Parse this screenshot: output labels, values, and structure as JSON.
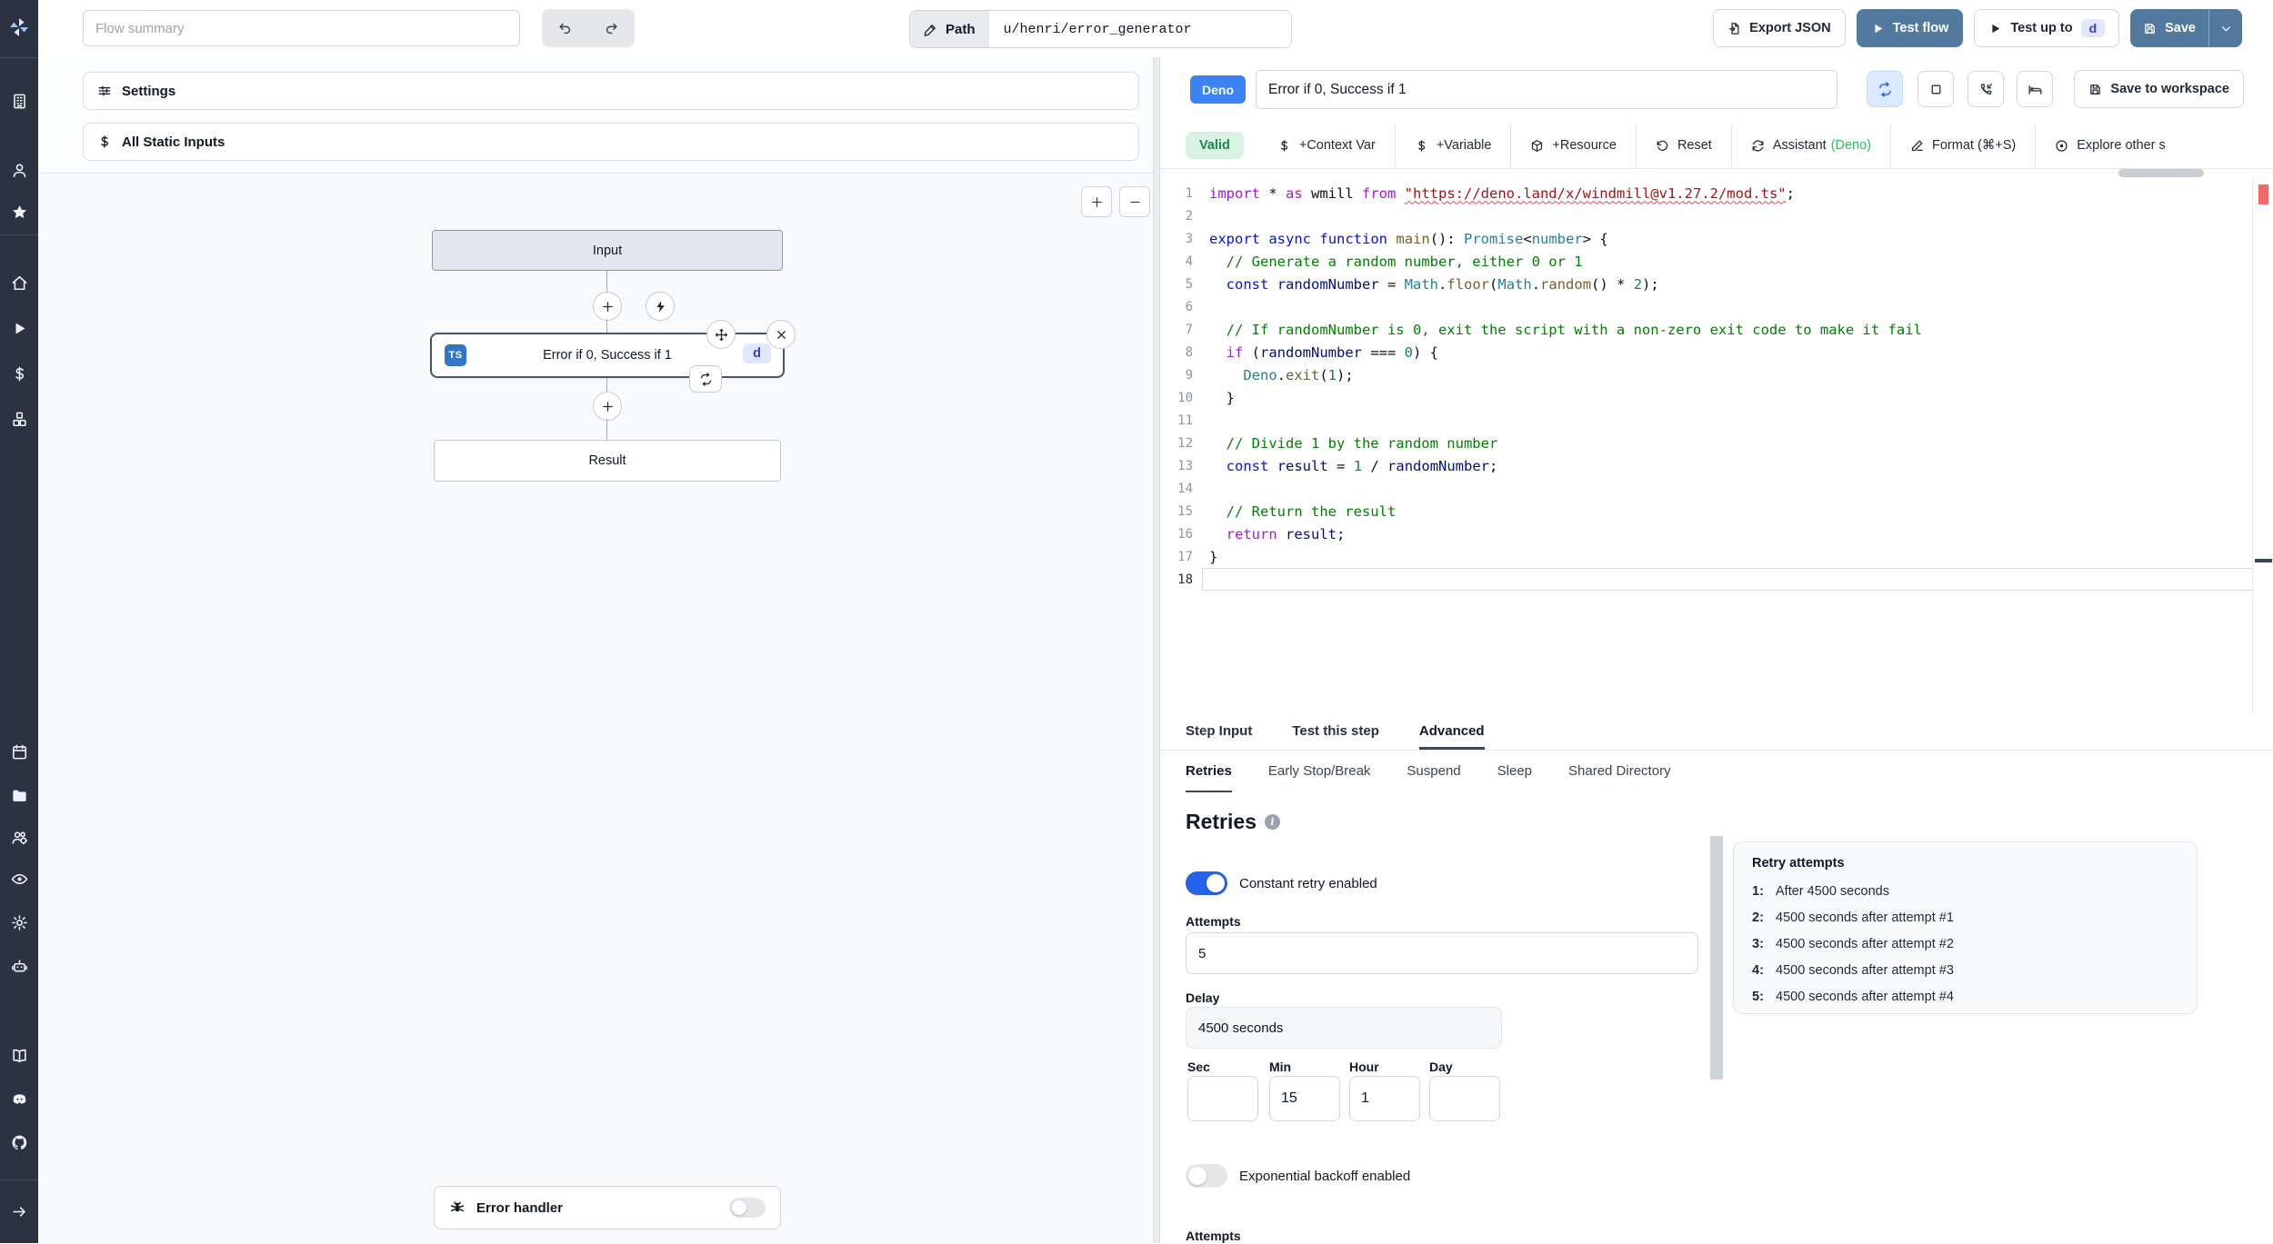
{
  "colors": {
    "sidebar_bg": "#2b3342",
    "primary_button": "#54799e",
    "deno_badge": "#3b82f6",
    "toggle_on": "#2563eb",
    "valid_bg": "#d8f3e3",
    "valid_text": "#178a4c",
    "step_badge_bg": "#e0e7ff",
    "step_badge_text": "#4338ca",
    "ts_badge": "#3077c6"
  },
  "sidebar": {
    "icons": [
      "building",
      "user",
      "star",
      "home",
      "play",
      "dollar",
      "cubes",
      "calendar",
      "folder",
      "users",
      "eye",
      "gear",
      "robot",
      "book",
      "discord",
      "github",
      "arrow-right"
    ]
  },
  "topbar": {
    "flow_summary_placeholder": "Flow summary",
    "path_label": "Path",
    "path_value": "u/henri/error_generator",
    "export_json": "Export JSON",
    "test_flow": "Test flow",
    "test_up_to": "Test up to",
    "test_up_to_badge": "d",
    "save": "Save"
  },
  "left_panel": {
    "settings": "Settings",
    "static_inputs": "All Static Inputs",
    "nodes": {
      "input": "Input",
      "step_title": "Error if 0, Success if 1",
      "step_lang_badge": "TS",
      "step_id_badge": "d",
      "result": "Result"
    },
    "error_handler": "Error handler"
  },
  "step_header": {
    "lang": "Deno",
    "title": "Error if 0, Success if 1",
    "icon_buttons": [
      "repeat",
      "square",
      "phone-in",
      "bed"
    ],
    "save_to_workspace": "Save to workspace"
  },
  "code_toolbar": {
    "valid": "Valid",
    "items": [
      {
        "icon": "dollar",
        "label": "+Context Var"
      },
      {
        "icon": "dollar",
        "label": "+Variable"
      },
      {
        "icon": "cube",
        "label": "+Resource"
      },
      {
        "icon": "rotate-ccw",
        "label": "Reset"
      },
      {
        "icon": "refresh",
        "label": "Assistant ",
        "suffix": "(Deno)"
      },
      {
        "icon": "pen",
        "label": "Format (⌘+S)"
      },
      {
        "icon": "explore",
        "label": "Explore other s"
      }
    ]
  },
  "editor": {
    "lines": [
      {
        "n": 1,
        "toks": [
          [
            "p",
            "import"
          ],
          [
            "d",
            " * "
          ],
          [
            "p",
            "as"
          ],
          [
            "d",
            " wmill "
          ],
          [
            "p",
            "from"
          ],
          [
            "d",
            " "
          ],
          [
            "u",
            "\"https://deno.land/x/windmill@v1.27.2/mod.ts\""
          ],
          [
            "d",
            ";"
          ]
        ]
      },
      {
        "n": 2,
        "toks": []
      },
      {
        "n": 3,
        "toks": [
          [
            "k",
            "export"
          ],
          [
            "d",
            " "
          ],
          [
            "k",
            "async"
          ],
          [
            "d",
            " "
          ],
          [
            "k",
            "function"
          ],
          [
            "d",
            " "
          ],
          [
            "f",
            "main"
          ],
          [
            "d",
            "(): "
          ],
          [
            "t",
            "Promise"
          ],
          [
            "d",
            "<"
          ],
          [
            "t",
            "number"
          ],
          [
            "d",
            "> {"
          ]
        ]
      },
      {
        "n": 4,
        "toks": [
          [
            "c",
            "  // Generate a random number, either 0 or 1"
          ]
        ]
      },
      {
        "n": 5,
        "toks": [
          [
            "d",
            "  "
          ],
          [
            "k",
            "const"
          ],
          [
            "d",
            " "
          ],
          [
            "v",
            "randomNumber"
          ],
          [
            "d",
            " = "
          ],
          [
            "t",
            "Math"
          ],
          [
            "d",
            "."
          ],
          [
            "f",
            "floor"
          ],
          [
            "d",
            "("
          ],
          [
            "t",
            "Math"
          ],
          [
            "d",
            "."
          ],
          [
            "f",
            "random"
          ],
          [
            "d",
            "() * "
          ],
          [
            "n",
            "2"
          ],
          [
            "d",
            ");"
          ]
        ]
      },
      {
        "n": 6,
        "toks": []
      },
      {
        "n": 7,
        "toks": [
          [
            "c",
            "  // If randomNumber is 0, exit the script with a non-zero exit code to make it fail"
          ]
        ]
      },
      {
        "n": 8,
        "toks": [
          [
            "d",
            "  "
          ],
          [
            "p",
            "if"
          ],
          [
            "d",
            " ("
          ],
          [
            "v",
            "randomNumber"
          ],
          [
            "d",
            " === "
          ],
          [
            "n",
            "0"
          ],
          [
            "d",
            ") {"
          ]
        ]
      },
      {
        "n": 9,
        "toks": [
          [
            "d",
            "    "
          ],
          [
            "t",
            "Deno"
          ],
          [
            "d",
            "."
          ],
          [
            "f",
            "exit"
          ],
          [
            "d",
            "("
          ],
          [
            "n",
            "1"
          ],
          [
            "d",
            ");"
          ]
        ]
      },
      {
        "n": 10,
        "toks": [
          [
            "d",
            "  }"
          ]
        ]
      },
      {
        "n": 11,
        "toks": []
      },
      {
        "n": 12,
        "toks": [
          [
            "c",
            "  // Divide 1 by the random number"
          ]
        ]
      },
      {
        "n": 13,
        "toks": [
          [
            "d",
            "  "
          ],
          [
            "k",
            "const"
          ],
          [
            "d",
            " "
          ],
          [
            "v",
            "result"
          ],
          [
            "d",
            " = "
          ],
          [
            "n",
            "1"
          ],
          [
            "d",
            " / "
          ],
          [
            "v",
            "randomNumber"
          ],
          [
            "d",
            ";"
          ]
        ]
      },
      {
        "n": 14,
        "toks": []
      },
      {
        "n": 15,
        "toks": [
          [
            "c",
            "  // Return the result"
          ]
        ]
      },
      {
        "n": 16,
        "toks": [
          [
            "d",
            "  "
          ],
          [
            "p",
            "return"
          ],
          [
            "d",
            " "
          ],
          [
            "v",
            "result"
          ],
          [
            "d",
            ";"
          ]
        ]
      },
      {
        "n": 17,
        "toks": [
          [
            "d",
            "}"
          ]
        ]
      },
      {
        "n": 18,
        "toks": [],
        "current": true
      }
    ]
  },
  "step_panel": {
    "tabs": [
      {
        "label": "Step Input",
        "active": false
      },
      {
        "label": "Test this step",
        "active": false
      },
      {
        "label": "Advanced",
        "active": true
      }
    ],
    "subtabs": [
      {
        "label": "Retries",
        "active": true
      },
      {
        "label": "Early Stop/Break",
        "active": false
      },
      {
        "label": "Suspend",
        "active": false
      },
      {
        "label": "Sleep",
        "active": false
      },
      {
        "label": "Shared Directory",
        "active": false
      }
    ]
  },
  "retries": {
    "heading": "Retries",
    "constant_toggle_label": "Constant retry enabled",
    "attempts_label": "Attempts",
    "attempts_value": "5",
    "delay_label": "Delay",
    "delay_value": "4500 seconds",
    "units": [
      {
        "label": "Sec",
        "value": ""
      },
      {
        "label": "Min",
        "value": "15"
      },
      {
        "label": "Hour",
        "value": "1"
      },
      {
        "label": "Day",
        "value": ""
      }
    ],
    "exponential_toggle_label": "Exponential backoff enabled",
    "cutoff_label": "Attempts"
  },
  "retry_box": {
    "title": "Retry attempts",
    "items": [
      {
        "n": "1:",
        "t": "After 4500 seconds"
      },
      {
        "n": "2:",
        "t": "4500 seconds after attempt #1"
      },
      {
        "n": "3:",
        "t": "4500 seconds after attempt #2"
      },
      {
        "n": "4:",
        "t": "4500 seconds after attempt #3"
      },
      {
        "n": "5:",
        "t": "4500 seconds after attempt #4"
      }
    ]
  }
}
